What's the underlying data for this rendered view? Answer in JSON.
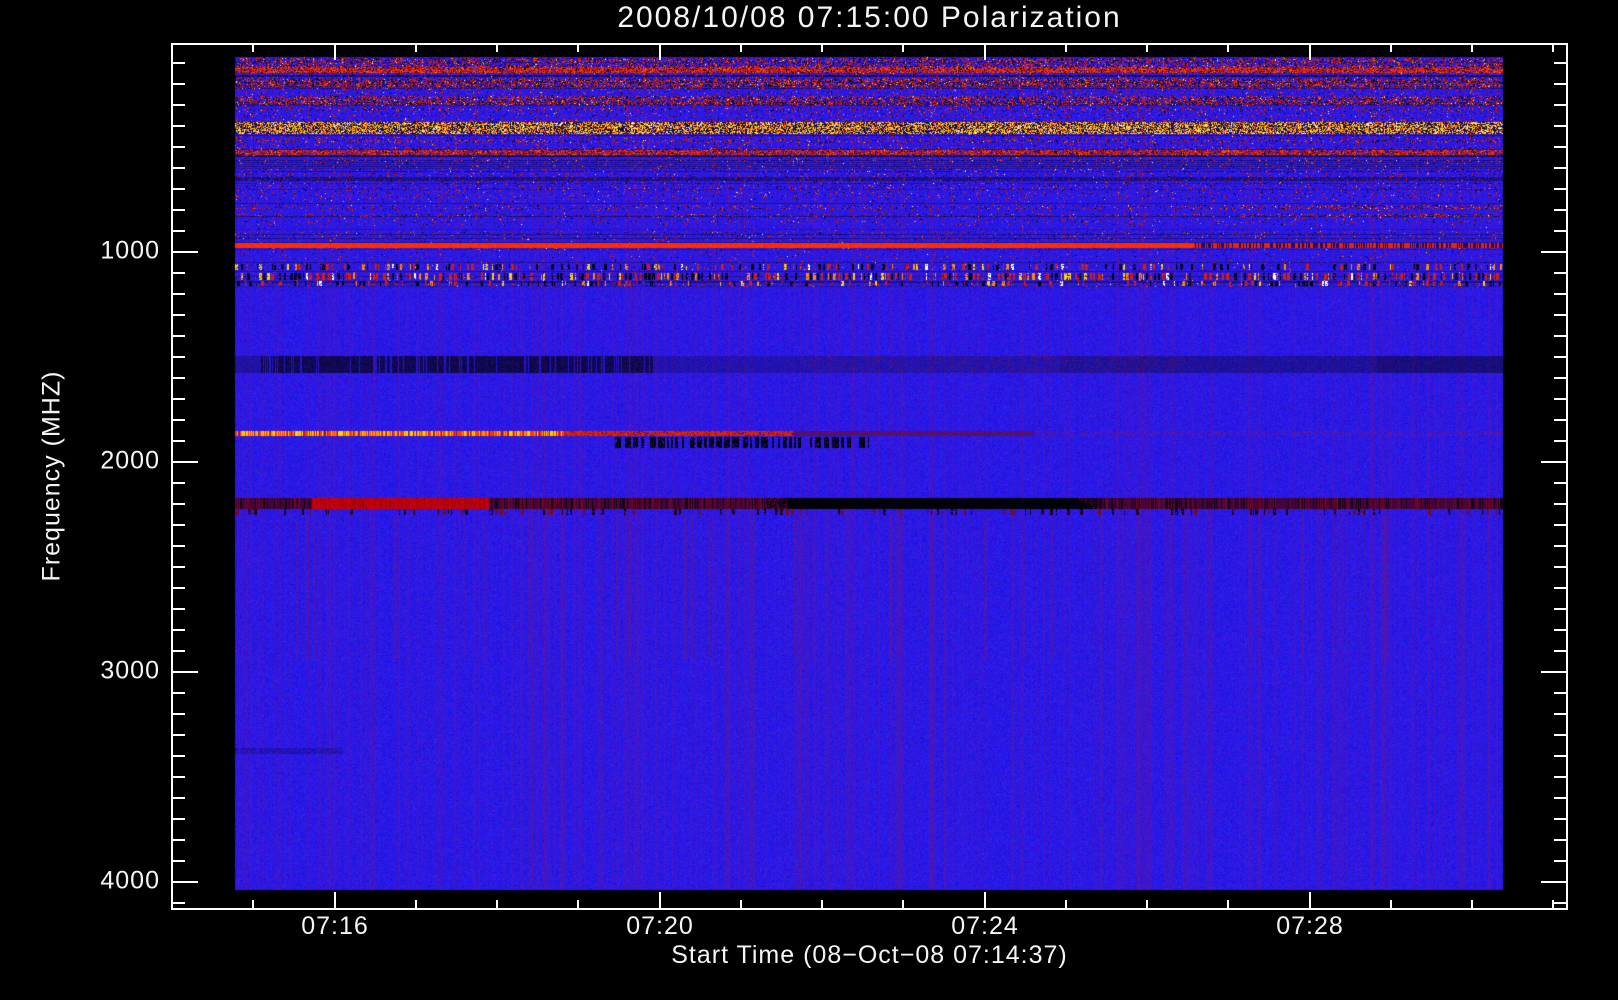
{
  "title": "2008/10/08 07:15:00 Polarization",
  "chart_data": {
    "type": "heatmap",
    "title": "2008/10/08 07:15:00 Polarization",
    "xlabel": "Start Time (08−Oct−08 07:14:37)",
    "ylabel": "Frequency (MHZ)",
    "x_axis_start": "07:14:00",
    "x_axis_end": "07:31:10",
    "x_major_ticks": [
      "07:16",
      "07:20",
      "07:24",
      "07:28"
    ],
    "x_minor_step_seconds": 60,
    "y_major_ticks": [
      1000,
      2000,
      3000,
      4000
    ],
    "y_minor_step_mhz": 100,
    "ylim_mhz": [
      10,
      4124
    ],
    "data_time_range": [
      "07:14:47",
      "07:30:40"
    ],
    "data_freq_range_mhz": [
      72,
      4040
    ],
    "grid": false,
    "legend": false,
    "colors": {
      "background": "#000000",
      "axes": "#ffffff",
      "field_base": "#2819e6",
      "field_stripe": "#5a14b4",
      "field_smudge": "#781478",
      "orange_line": "#ff3c00",
      "bright_red": "#e60000",
      "dark_red_band": "#4b000f",
      "black_patch": "#000006"
    },
    "palettes": {
      "zone": {
        "colors": [
          "#c81e00",
          "#ff3200",
          "#140a28",
          "#000008",
          "#501878",
          "#ff8c00",
          "#ffd20a",
          "#ffffff"
        ],
        "weights": [
          30,
          20,
          22,
          12,
          8,
          5,
          2,
          1
        ]
      },
      "streak": {
        "colors": [
          "#e62000",
          "#ff3c00",
          "#961000",
          "#0a0014",
          "#ff7800"
        ],
        "weights": [
          35,
          25,
          20,
          12,
          8
        ]
      },
      "rfi": {
        "colors": [
          "#ffd200",
          "#ff9600",
          "#ff3c00",
          "#ffffff",
          "#b4b4b4"
        ],
        "weights": [
          38,
          22,
          20,
          12,
          8
        ]
      },
      "dash": {
        "colors": [
          "#000008",
          "#dc1e00",
          "#ff8c00",
          "#ffd200",
          "#ffffff"
        ],
        "weights": [
          42,
          30,
          12,
          10,
          6
        ]
      }
    },
    "noise_zone": {
      "f0": 72,
      "f1": 1160,
      "note": "dense speckled interference region above ~1000 MHz line"
    },
    "bands": [
      {
        "f0": 72,
        "f1": 115,
        "type": "speckle",
        "density": 0.33,
        "palette": "zone"
      },
      {
        "f0": 119,
        "f1": 148,
        "type": "streak",
        "density": 0.75
      },
      {
        "f0": 153,
        "f1": 167,
        "type": "dark",
        "alpha": 0.72
      },
      {
        "f0": 172,
        "f1": 210,
        "type": "speckle",
        "density": 0.5,
        "palette": "zone"
      },
      {
        "f0": 253,
        "f1": 300,
        "type": "speckle",
        "density": 0.42,
        "palette": "zone"
      },
      {
        "f0": 381,
        "f1": 434,
        "type": "rfi",
        "density": 0.55
      },
      {
        "f0": 467,
        "f1": 481,
        "type": "speckle",
        "density": 0.18,
        "palette": "zone"
      },
      {
        "f0": 510,
        "f1": 534,
        "type": "streak",
        "density": 0.58
      },
      {
        "f0": 539,
        "f1": 548,
        "type": "dark",
        "alpha": 0.62
      },
      {
        "f0": 639,
        "f1": 662,
        "type": "dark",
        "alpha": 0.5
      },
      {
        "f0": 696,
        "f1": 705,
        "type": "dark",
        "alpha": 0.32
      },
      {
        "f0": 772,
        "f1": 791,
        "type": "speckle",
        "density": 0.12,
        "palette": "zone",
        "xboost_from": 0.79,
        "xboost_density": 0.35
      },
      {
        "f0": 815,
        "f1": 829,
        "type": "speckle",
        "density": 0.1,
        "palette": "zone",
        "xboost_from": 0.79,
        "xboost_density": 0.28
      },
      {
        "f0": 953,
        "f1": 977,
        "type": "solidline",
        "color": "#ff3c00",
        "stripe_from": 0.755
      },
      {
        "f0": 1053,
        "f1": 1086,
        "type": "dash",
        "density": 0.2
      },
      {
        "f0": 1096,
        "f1": 1129,
        "type": "dash",
        "density": 0.33
      },
      {
        "f0": 1134,
        "f1": 1158,
        "type": "dash",
        "density": 0.14
      },
      {
        "f0": 1491,
        "f1": 1572,
        "type": "darkband"
      },
      {
        "f0": 1848,
        "f1": 1876,
        "type": "brightline"
      },
      {
        "f0": 1881,
        "f1": 1929,
        "type": "blackdash",
        "x0": 0.3,
        "x1": 0.5,
        "density": 0.45
      },
      {
        "f0": 2167,
        "f1": 2220,
        "type": "mainband",
        "bright_x": [
          0.06,
          0.2
        ],
        "black_x": [
          0.42,
          0.68
        ]
      },
      {
        "f0": 2224,
        "f1": 2248,
        "type": "dash",
        "density": 0.1,
        "darkonly": true
      },
      {
        "f0": 3362,
        "f1": 3386,
        "type": "dark",
        "alpha": 0.32,
        "x0": 0.0,
        "x1": 0.085
      }
    ]
  }
}
